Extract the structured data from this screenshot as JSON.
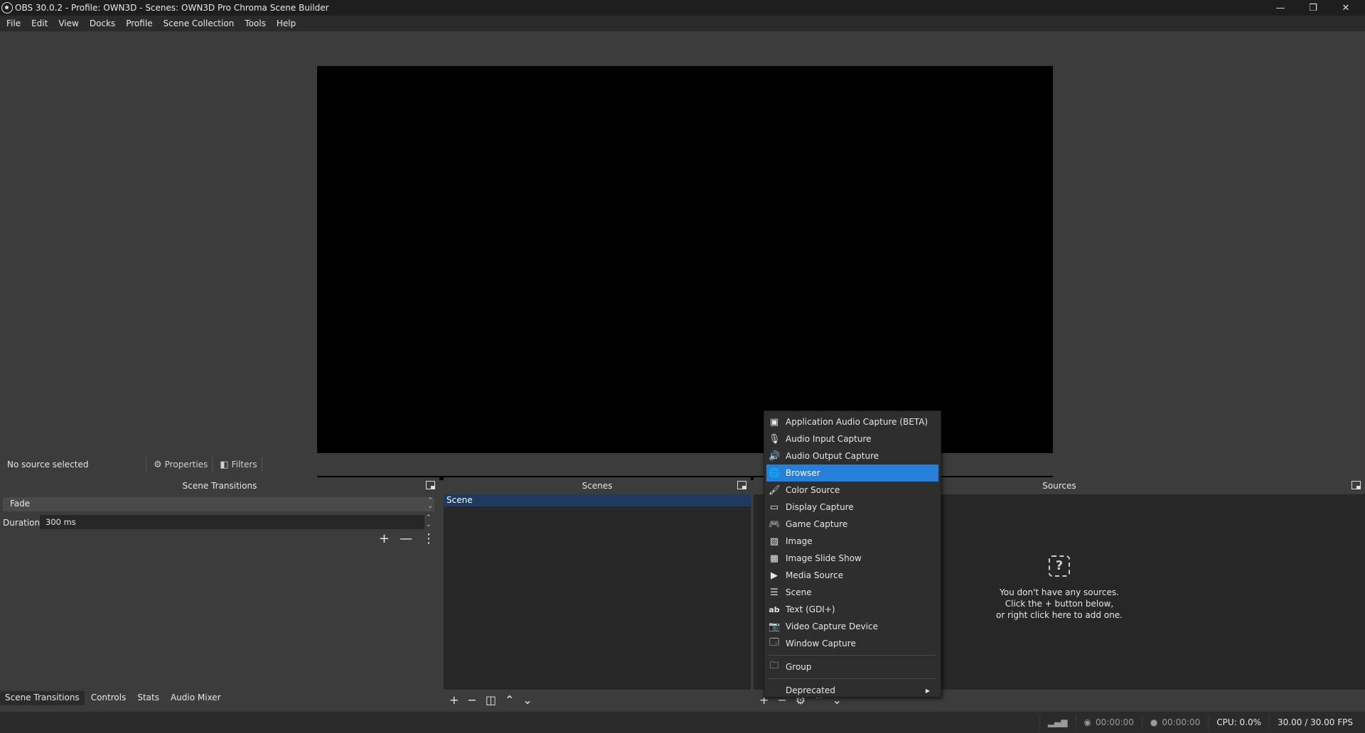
{
  "window": {
    "title": "OBS 30.0.2 - Profile: OWN3D - Scenes: OWN3D Pro Chroma Scene Builder",
    "minimize": "—",
    "restore": "❐",
    "close": "✕"
  },
  "menubar": [
    "File",
    "Edit",
    "View",
    "Docks",
    "Profile",
    "Scene Collection",
    "Tools",
    "Help"
  ],
  "context_bar": {
    "no_source": "No source selected",
    "properties": "Properties",
    "filters": "Filters"
  },
  "transitions": {
    "title": "Scene Transitions",
    "selected": "Fade",
    "duration_label": "Duration",
    "duration_value": "300 ms",
    "add": "+",
    "remove": "—",
    "more": "⋮"
  },
  "scenes": {
    "title": "Scenes",
    "items": [
      "Scene"
    ]
  },
  "sources": {
    "title": "Sources",
    "empty_line1": "You don't have any sources.",
    "empty_line2": "Click the + button below,",
    "empty_line3": "or right click here to add one."
  },
  "bottom_tabs": [
    "Scene Transitions",
    "Controls",
    "Stats",
    "Audio Mixer"
  ],
  "status": {
    "stream_time": "00:00:00",
    "record_time": "00:00:00",
    "cpu": "CPU: 0.0%",
    "fps": "30.00 / 30.00 FPS"
  },
  "menu": {
    "items": [
      {
        "label": "Application Audio Capture (BETA)",
        "icon": "app-audio-icon"
      },
      {
        "label": "Audio Input Capture",
        "icon": "microphone-icon"
      },
      {
        "label": "Audio Output Capture",
        "icon": "speaker-icon"
      },
      {
        "label": "Browser",
        "icon": "globe-icon"
      },
      {
        "label": "Color Source",
        "icon": "brush-icon"
      },
      {
        "label": "Display Capture",
        "icon": "monitor-icon"
      },
      {
        "label": "Game Capture",
        "icon": "gamepad-icon"
      },
      {
        "label": "Image",
        "icon": "image-icon"
      },
      {
        "label": "Image Slide Show",
        "icon": "slideshow-icon"
      },
      {
        "label": "Media Source",
        "icon": "play-icon"
      },
      {
        "label": "Scene",
        "icon": "list-icon"
      },
      {
        "label": "Text (GDI+)",
        "icon": "text-icon"
      },
      {
        "label": "Video Capture Device",
        "icon": "camera-icon"
      },
      {
        "label": "Window Capture",
        "icon": "window-icon"
      }
    ],
    "group": "Group",
    "deprecated": "Deprecated",
    "selected_index": 3
  },
  "colors": {
    "accent": "#2680d9",
    "background": "#3c3c3c",
    "panel": "#272727"
  }
}
